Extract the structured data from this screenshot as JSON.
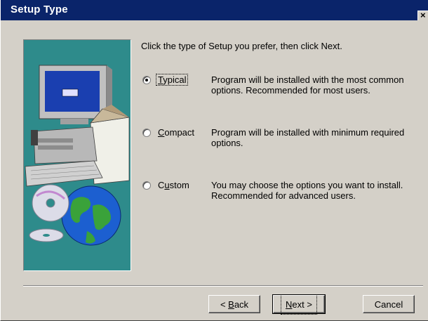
{
  "window": {
    "title": "Setup Type",
    "close_glyph": "×"
  },
  "main": {
    "prompt": "Click the type of Setup you prefer, then click Next."
  },
  "options": [
    {
      "label_pre": "",
      "label_mn": "T",
      "label_post": "ypical",
      "selected": true,
      "description_1": "Program will be installed with the most common",
      "description_2": "options.  Recommended for most users."
    },
    {
      "label_pre": "",
      "label_mn": "C",
      "label_post": "ompact",
      "selected": false,
      "description_1": "Program will be installed with minimum required",
      "description_2": "options."
    },
    {
      "label_pre": "C",
      "label_mn": "u",
      "label_post": "stom",
      "selected": false,
      "description_1": "You may choose the options you want to install.",
      "description_2": "Recommended for advanced users."
    }
  ],
  "buttons": {
    "back": {
      "pre": "< ",
      "mn": "B",
      "post": "ack"
    },
    "next": {
      "pre": "",
      "mn": "N",
      "post": "ext >"
    },
    "cancel": "Cancel"
  },
  "art": {
    "icon": "computer-cd-globe-illustration",
    "background_color": "#2e8b8b"
  }
}
